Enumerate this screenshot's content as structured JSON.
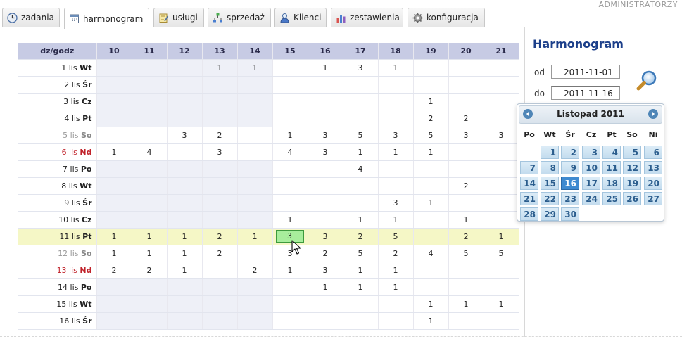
{
  "header": {
    "user_label": "ADMINISTRATORZY"
  },
  "tabs": [
    {
      "label": "zadania",
      "icon": "clock-icon"
    },
    {
      "label": "harmonogram",
      "icon": "calendar-icon",
      "active": true
    },
    {
      "label": "usługi",
      "icon": "notepad-icon"
    },
    {
      "label": "sprzedaż",
      "icon": "org-chart-icon"
    },
    {
      "label": "Klienci",
      "icon": "user-icon"
    },
    {
      "label": "zestawienia",
      "icon": "bar-chart-icon"
    },
    {
      "label": "konfiguracja",
      "icon": "gear-icon"
    }
  ],
  "side": {
    "title": "Harmonogram",
    "from_label": "od",
    "from_value": "2011-11-01",
    "to_label": "do",
    "to_value": "2011-11-16",
    "search_icon": "magnifier-icon"
  },
  "calendar": {
    "title": "Listopad 2011",
    "weekdays": [
      "Po",
      "Wt",
      "Śr",
      "Cz",
      "Pt",
      "So",
      "Ni"
    ],
    "first_weekday_index": 1,
    "days": [
      "1",
      "2",
      "3",
      "4",
      "5",
      "6",
      "7",
      "8",
      "9",
      "10",
      "11",
      "12",
      "13",
      "14",
      "15",
      "16",
      "17",
      "18",
      "19",
      "20",
      "21",
      "22",
      "23",
      "24",
      "25",
      "26",
      "27",
      "28",
      "29",
      "30"
    ],
    "selected_day": "16"
  },
  "grid": {
    "corner_label": "dz/godz",
    "hours": [
      "10",
      "11",
      "12",
      "13",
      "14",
      "15",
      "16",
      "17",
      "18",
      "19",
      "20",
      "21"
    ],
    "rows": [
      {
        "date": "1 lis",
        "dow": "Wt",
        "type": "work",
        "cells": [
          "",
          "",
          "",
          "1",
          "1",
          "",
          "1",
          "3",
          "1",
          "",
          "",
          ""
        ]
      },
      {
        "date": "2 lis",
        "dow": "Śr",
        "type": "work",
        "cells": [
          "",
          "",
          "",
          "",
          "",
          "",
          "",
          "",
          "",
          "",
          "",
          ""
        ]
      },
      {
        "date": "3 lis",
        "dow": "Cz",
        "type": "work",
        "cells": [
          "",
          "",
          "",
          "",
          "",
          "",
          "",
          "",
          "",
          "1",
          "",
          ""
        ]
      },
      {
        "date": "4 lis",
        "dow": "Pt",
        "type": "work",
        "cells": [
          "",
          "",
          "",
          "",
          "",
          "",
          "",
          "",
          "",
          "2",
          "2",
          ""
        ]
      },
      {
        "date": "5 lis",
        "dow": "So",
        "type": "sat",
        "cells": [
          "",
          "",
          "3",
          "2",
          "",
          "1",
          "3",
          "5",
          "3",
          "5",
          "3",
          "3"
        ]
      },
      {
        "date": "6 lis",
        "dow": "Nd",
        "type": "sun",
        "cells": [
          "1",
          "4",
          "",
          "3",
          "",
          "4",
          "3",
          "1",
          "1",
          "1",
          "",
          ""
        ]
      },
      {
        "date": "7 lis",
        "dow": "Po",
        "type": "work",
        "cells": [
          "",
          "",
          "",
          "",
          "",
          "",
          "",
          "4",
          "",
          "",
          "",
          ""
        ]
      },
      {
        "date": "8 lis",
        "dow": "Wt",
        "type": "work",
        "cells": [
          "",
          "",
          "",
          "",
          "",
          "",
          "",
          "",
          "",
          "",
          "2",
          ""
        ]
      },
      {
        "date": "9 lis",
        "dow": "Śr",
        "type": "work",
        "cells": [
          "",
          "",
          "",
          "",
          "",
          "",
          "",
          "",
          "3",
          "1",
          "",
          ""
        ]
      },
      {
        "date": "10 lis",
        "dow": "Cz",
        "type": "work",
        "cells": [
          "",
          "",
          "",
          "",
          "",
          "1",
          "",
          "1",
          "1",
          "",
          "1",
          ""
        ]
      },
      {
        "date": "11 lis",
        "dow": "Pt",
        "type": "work",
        "highlight": true,
        "cells": [
          "1",
          "1",
          "1",
          "2",
          "1",
          "3",
          "3",
          "2",
          "5",
          "",
          "2",
          "1"
        ]
      },
      {
        "date": "12 lis",
        "dow": "So",
        "type": "sat",
        "cells": [
          "1",
          "1",
          "1",
          "2",
          "",
          "3",
          "2",
          "5",
          "2",
          "4",
          "5",
          "5"
        ]
      },
      {
        "date": "13 lis",
        "dow": "Nd",
        "type": "sun",
        "cells": [
          "2",
          "2",
          "1",
          "",
          "2",
          "1",
          "3",
          "1",
          "1",
          "",
          "",
          ""
        ]
      },
      {
        "date": "14 lis",
        "dow": "Po",
        "type": "work",
        "cells": [
          "",
          "",
          "",
          "",
          "",
          "",
          "1",
          "1",
          "1",
          "",
          "",
          ""
        ]
      },
      {
        "date": "15 lis",
        "dow": "Wt",
        "type": "work",
        "cells": [
          "",
          "",
          "",
          "",
          "",
          "",
          "",
          "",
          "",
          "1",
          "1",
          "1"
        ]
      },
      {
        "date": "16 lis",
        "dow": "Śr",
        "type": "work",
        "cells": [
          "",
          "",
          "",
          "",
          "",
          "",
          "",
          "",
          "",
          "1",
          "",
          ""
        ]
      }
    ],
    "selected_cell": {
      "row": 10,
      "col": 5
    }
  },
  "colors": {
    "header_bg": "#c7cbe4",
    "grey_cell": "#eef0f7",
    "highlight_row": "#f5f7c6",
    "selected_cell": "#a8ee9c",
    "sunday_text": "#c0222a",
    "calendar_day": "#c3dcee",
    "calendar_selected": "#3f8ad0",
    "title_blue": "#1c3f8a"
  }
}
